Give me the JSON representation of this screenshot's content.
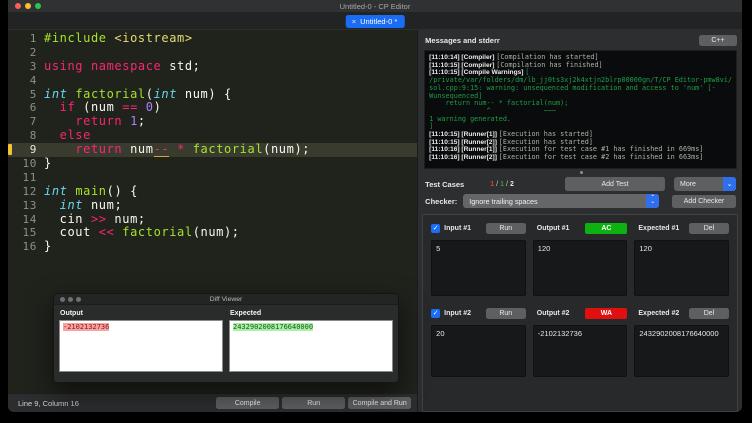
{
  "icons": {
    "close": "×",
    "check": "✓",
    "chevron_down": "⌄",
    "select_up": "⌃",
    "select_down": "⌄"
  },
  "window": {
    "title": "Untitled-0 - CP Editor"
  },
  "tab": {
    "label": "Untitled-0 *"
  },
  "editor": {
    "current_line": 9,
    "lines": [
      {
        "n": "1",
        "tokens": [
          [
            "pp",
            "#include "
          ],
          [
            "str",
            "<iostream>"
          ]
        ]
      },
      {
        "n": "2",
        "tokens": []
      },
      {
        "n": "3",
        "tokens": [
          [
            "kw",
            "using namespace"
          ],
          [
            "fg",
            " std;"
          ]
        ]
      },
      {
        "n": "4",
        "tokens": []
      },
      {
        "n": "5",
        "tokens": [
          [
            "type",
            "int"
          ],
          [
            "fg",
            " "
          ],
          [
            "fn",
            "factorial"
          ],
          [
            "fg",
            "("
          ],
          [
            "type",
            "int"
          ],
          [
            "fg",
            " num) {"
          ]
        ]
      },
      {
        "n": "6",
        "tokens": [
          [
            "fg",
            "  "
          ],
          [
            "kw",
            "if"
          ],
          [
            "fg",
            " (num "
          ],
          [
            "kw",
            "=="
          ],
          [
            "fg",
            " "
          ],
          [
            "num",
            "0"
          ],
          [
            "fg",
            ")"
          ]
        ]
      },
      {
        "n": "7",
        "tokens": [
          [
            "fg",
            "    "
          ],
          [
            "kw",
            "return"
          ],
          [
            "fg",
            " "
          ],
          [
            "num",
            "1"
          ],
          [
            "fg",
            ";"
          ]
        ]
      },
      {
        "n": "8",
        "tokens": [
          [
            "fg",
            "  "
          ],
          [
            "kw",
            "else"
          ]
        ]
      },
      {
        "n": "9",
        "tokens": [
          [
            "fg",
            "    "
          ],
          [
            "kw",
            "return"
          ],
          [
            "fg",
            " num"
          ],
          [
            "warn",
            "--"
          ],
          [
            "fg",
            " "
          ],
          [
            "kw",
            "*"
          ],
          [
            "fg",
            " "
          ],
          [
            "fn",
            "factorial"
          ],
          [
            "fg",
            "(num);"
          ]
        ]
      },
      {
        "n": "10",
        "tokens": [
          [
            "fg",
            "}"
          ]
        ]
      },
      {
        "n": "11",
        "tokens": []
      },
      {
        "n": "12",
        "tokens": [
          [
            "type",
            "int"
          ],
          [
            "fg",
            " "
          ],
          [
            "fn",
            "main"
          ],
          [
            "fg",
            "() {"
          ]
        ]
      },
      {
        "n": "13",
        "tokens": [
          [
            "fg",
            "  "
          ],
          [
            "type",
            "int"
          ],
          [
            "fg",
            " num;"
          ]
        ]
      },
      {
        "n": "14",
        "tokens": [
          [
            "fg",
            "  cin "
          ],
          [
            "kw",
            ">>"
          ],
          [
            "fg",
            " num;"
          ]
        ]
      },
      {
        "n": "15",
        "tokens": [
          [
            "fg",
            "  cout "
          ],
          [
            "kw",
            "<<"
          ],
          [
            "fg",
            " "
          ],
          [
            "fn",
            "factorial"
          ],
          [
            "fg",
            "(num);"
          ]
        ]
      },
      {
        "n": "16",
        "tokens": [
          [
            "fg",
            "}"
          ]
        ]
      }
    ]
  },
  "statusbar": {
    "position": "Line 9, Column 16",
    "compile_label": "Compile",
    "run_label": "Run",
    "compile_and_run_label": "Compile and Run"
  },
  "messages": {
    "header": "Messages and stderr",
    "language_button": "C++",
    "log": [
      [
        [
          "label",
          "[11:10:14] [Compiler] "
        ],
        [
          "msg",
          "[Compilation has started]"
        ]
      ],
      [
        [
          "label",
          "[11:10:15] [Compiler] "
        ],
        [
          "msg",
          "[Compilation has finished]"
        ]
      ],
      [
        [
          "label",
          "[11:10:15] [Compile Warnings] "
        ],
        [
          "warn",
          "["
        ]
      ],
      [
        [
          "warn",
          "/private/var/folders/dm/lb_jj0ts3xj2k4xtjn2blrp00000gn/T/CP Editor-pmw8vi/"
        ]
      ],
      [
        [
          "warn",
          "sol.cpp:9:15: warning: unsequenced modification and access to 'num' [-"
        ]
      ],
      [
        [
          "warn",
          "Wunsequenced]"
        ]
      ],
      [
        [
          "warn",
          "    return num-- * factorial(num);"
        ]
      ],
      [
        [
          "warn",
          "              ^             ~~~"
        ]
      ],
      [
        [
          "warn",
          "1 warning generated."
        ]
      ],
      [
        [
          "warn",
          "]"
        ]
      ],
      [
        [
          "label",
          "[11:10:15] [Runner[1]] "
        ],
        [
          "msg",
          "[Execution has started]"
        ]
      ],
      [
        [
          "label",
          "[11:10:15] [Runner[2]] "
        ],
        [
          "msg",
          "[Execution has started]"
        ]
      ],
      [
        [
          "label",
          "[11:10:16] [Runner[1]] "
        ],
        [
          "msg",
          "[Execution for test case #1 has finished in 669ms]"
        ]
      ],
      [
        [
          "label",
          "[11:10:16] [Runner[2]] "
        ],
        [
          "msg",
          "[Execution for test case #2 has finished in 663ms]"
        ]
      ]
    ]
  },
  "testcases_header": {
    "title": "Test Cases",
    "wa_count": "1",
    "ac_count": "1",
    "total_count": "2",
    "separator": "/",
    "add_test_label": "Add Test",
    "more_label": "More"
  },
  "checker": {
    "label": "Checker:",
    "selected": "Ignore trailing spaces",
    "add_checker_label": "Add Checker"
  },
  "testcases": [
    {
      "input_label": "Input #1",
      "run_label": "Run",
      "output_label": "Output #1",
      "verdict": "AC",
      "verdict_color": "#0db211",
      "expected_label": "Expected #1",
      "del_label": "Del",
      "input": "5",
      "output": "120",
      "expected": "120",
      "checked": true
    },
    {
      "input_label": "Input #2",
      "run_label": "Run",
      "output_label": "Output #2",
      "verdict": "WA",
      "verdict_color": "#e01010",
      "expected_label": "Expected #2",
      "del_label": "Del",
      "input": "20",
      "output": "-2102132736",
      "expected": "2432902008176640000",
      "checked": true
    }
  ],
  "diff_viewer": {
    "title": "Diff Viewer",
    "output_label": "Output",
    "expected_label": "Expected",
    "output_value": "-2102132736",
    "expected_value": "2432902008176640000"
  }
}
